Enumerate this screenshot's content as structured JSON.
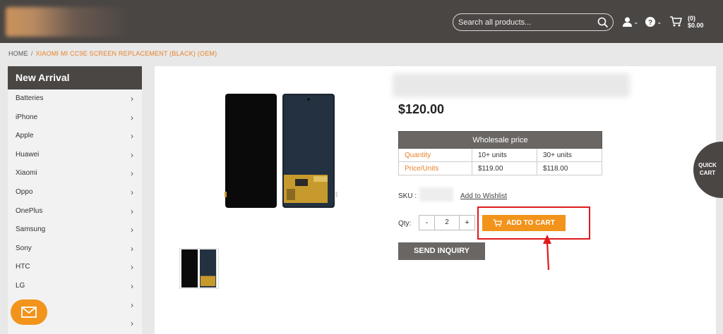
{
  "header": {
    "search_placeholder": "Search all products...",
    "cart_count": "(0)",
    "cart_total": "$0.00"
  },
  "breadcrumb": {
    "home": "HOME",
    "separator": "/",
    "current": "XIAOMI MI CC9E SCREEN REPLACEMENT (BLACK) (OEM)"
  },
  "sidebar": {
    "title": "New Arrival",
    "items": [
      {
        "label": "Batteries"
      },
      {
        "label": "iPhone"
      },
      {
        "label": "Apple"
      },
      {
        "label": "Huawei"
      },
      {
        "label": "Xiaomi"
      },
      {
        "label": "Oppo"
      },
      {
        "label": "OnePlus"
      },
      {
        "label": "Samsung"
      },
      {
        "label": "Sony"
      },
      {
        "label": "HTC"
      },
      {
        "label": "LG"
      },
      {
        "label": ""
      },
      {
        "label": ""
      }
    ]
  },
  "product": {
    "price": "$120.00",
    "wholesale": {
      "title": "Wholesale price",
      "quantity_label": "Quantity",
      "price_label": "Price/Units",
      "tiers": [
        {
          "qty": "10+ units",
          "price": "$119.00"
        },
        {
          "qty": "30+ units",
          "price": "$118.00"
        }
      ]
    },
    "sku_label": "SKU :",
    "wishlist_label": "Add to Wishlist",
    "qty_label": "Qty:",
    "qty_minus": "-",
    "qty_value": "2",
    "qty_plus": "+",
    "add_to_cart": "ADD TO CART",
    "send_inquiry": "SEND INQUIRY"
  },
  "quick_cart": {
    "line1": "QUICK",
    "line2": "CART"
  },
  "colors": {
    "accent": "#f2931b",
    "dark": "#4a4644",
    "highlight": "#e0191b",
    "link": "#e8822a"
  }
}
